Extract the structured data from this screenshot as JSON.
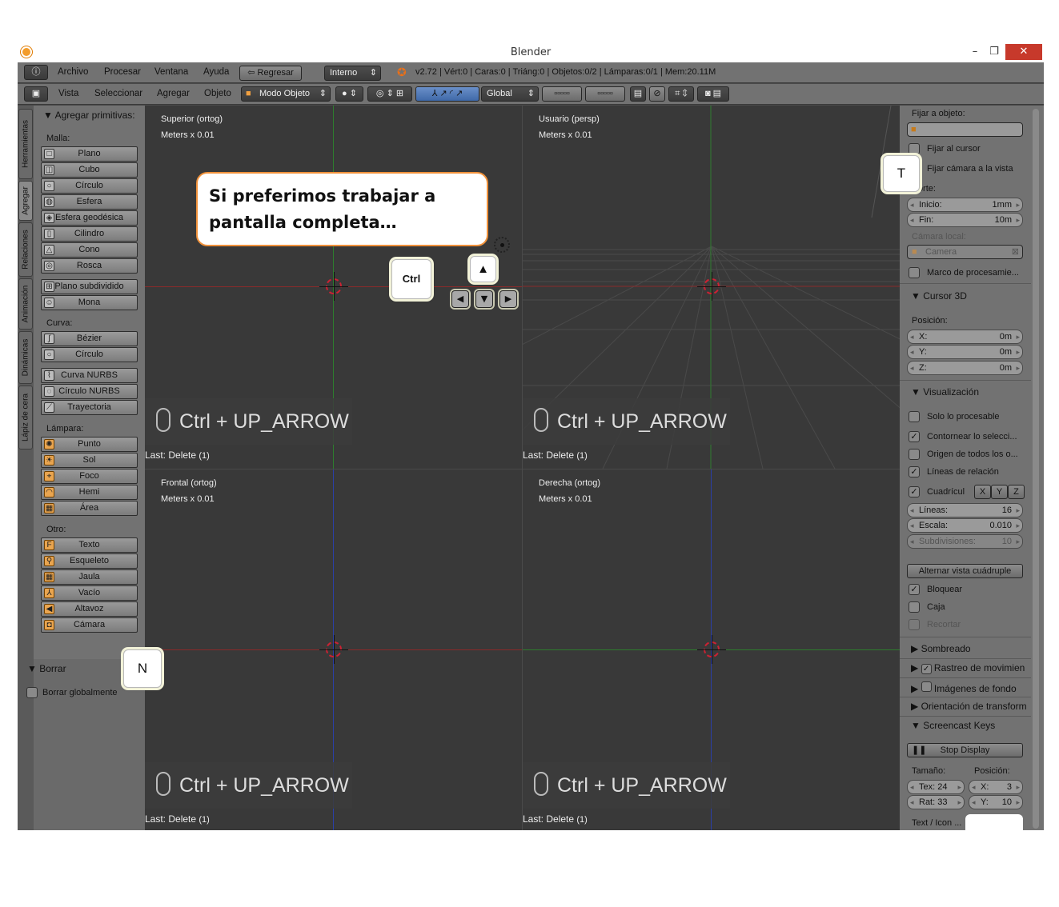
{
  "window": {
    "title": "Blender",
    "minimize": "–",
    "maximize": "❐",
    "close": "✕"
  },
  "header1": {
    "menus": [
      "Archivo",
      "Procesar",
      "Ventana",
      "Ayuda"
    ],
    "back_button": "Regresar",
    "engine": "Interno",
    "stats": "v2.72 | Vért:0 | Caras:0 | Triáng:0 | Objetos:0/2 | Lámparas:0/1 | Mem:20.11M"
  },
  "header2": {
    "menus": [
      "Vista",
      "Seleccionar",
      "Agregar",
      "Objeto"
    ],
    "mode": "Modo Objeto",
    "orientation": "Global"
  },
  "left_tabs": [
    "Herramientas",
    "Agregar",
    "Relaciones",
    "Animación",
    "Dinámicas",
    "Lápiz de cera"
  ],
  "toolshelf": {
    "title": "Agregar primitivas:",
    "malla_label": "Malla:",
    "malla": [
      "Plano",
      "Cubo",
      "Círculo",
      "Esfera",
      "Esfera geodésica",
      "Cilindro",
      "Cono",
      "Rosca",
      "Plano subdividido",
      "Mona"
    ],
    "curva_label": "Curva:",
    "curva": [
      "Bézier",
      "Círculo",
      "Curva NURBS",
      "Círculo NURBS",
      "Trayectoria"
    ],
    "lampara_label": "Lámpara:",
    "lampara": [
      "Punto",
      "Sol",
      "Foco",
      "Hemi",
      "Área"
    ],
    "otro_label": "Otro:",
    "otro": [
      "Texto",
      "Esqueleto",
      "Jaula",
      "Vacío",
      "Altavoz",
      "Cámara"
    ],
    "borrar_title": "Borrar",
    "borrar_global": "Borrar globalmente"
  },
  "viewports": [
    {
      "name": "Superior (ortog)",
      "unit": "Meters x 0.01",
      "keys": "Ctrl + UP_ARROW",
      "last": "Last: Delete",
      "count": "(1)"
    },
    {
      "name": "Usuario (persp)",
      "unit": "Meters x 0.01",
      "keys": "Ctrl + UP_ARROW",
      "last": "Last: Delete",
      "count": "(1)"
    },
    {
      "name": "Frontal (ortog)",
      "unit": "Meters x 0.01",
      "keys": "Ctrl + UP_ARROW",
      "last": "Last: Delete",
      "count": "(1)"
    },
    {
      "name": "Derecha (ortog)",
      "unit": "Meters x 0.01",
      "keys": "Ctrl + UP_ARROW",
      "last": "Last: Delete",
      "count": "(1)"
    }
  ],
  "props": {
    "fijar_objeto": "Fijar a objeto:",
    "fijar_cursor": "Fijar al cursor",
    "fijar_camara": "Fijar cámara a la vista",
    "corte": "Corte:",
    "inicio_k": "Inicio:",
    "inicio_v": "1mm",
    "fin_k": "Fin:",
    "fin_v": "10m",
    "camara_local": "Cámara local:",
    "camera": "Camera",
    "marco": "Marco de procesamie...",
    "cursor3d": "Cursor 3D",
    "posicion": "Posición:",
    "x_k": "X:",
    "x_v": "0m",
    "y_k": "Y:",
    "y_v": "0m",
    "z_k": "Z:",
    "z_v": "0m",
    "visualizacion": "Visualización",
    "solo": "Solo lo procesable",
    "contornear": "Contornear lo selecci...",
    "origen": "Origen de todos los o...",
    "lineas_rel": "Líneas de relación",
    "cuadricula": "Cuadrícul",
    "axes": [
      "X",
      "Y",
      "Z"
    ],
    "lineas_k": "Líneas:",
    "lineas_v": "16",
    "escala_k": "Escala:",
    "escala_v": "0.010",
    "subdiv_k": "Subdivisiones:",
    "subdiv_v": "10",
    "alternar": "Alternar vista cuádruple",
    "bloquear": "Bloquear",
    "caja": "Caja",
    "recortar": "Recortar",
    "sombreado": "Sombreado",
    "rastreo": "Rastreo de movimien",
    "imagenes": "Imágenes de fondo",
    "orientacion": "Orientación de transform",
    "screencast": "Screencast Keys",
    "stop": "Stop Display",
    "tamano": "Tamaño:",
    "posicion2": "Posición:",
    "tex": "Tex: 24",
    "rat": "Rat: 33",
    "px": "X:",
    "px_v": "3",
    "py": "Y:",
    "py_v": "10",
    "texticon": "Text / Icon ..."
  },
  "overlay": {
    "callout": "Si preferimos trabajar a pantalla completa…",
    "key_t": "T",
    "key_n": "N",
    "key_ctrl": "Ctrl",
    "key_up": "▲",
    "arrows": [
      "◀",
      "▼",
      "▶"
    ]
  }
}
